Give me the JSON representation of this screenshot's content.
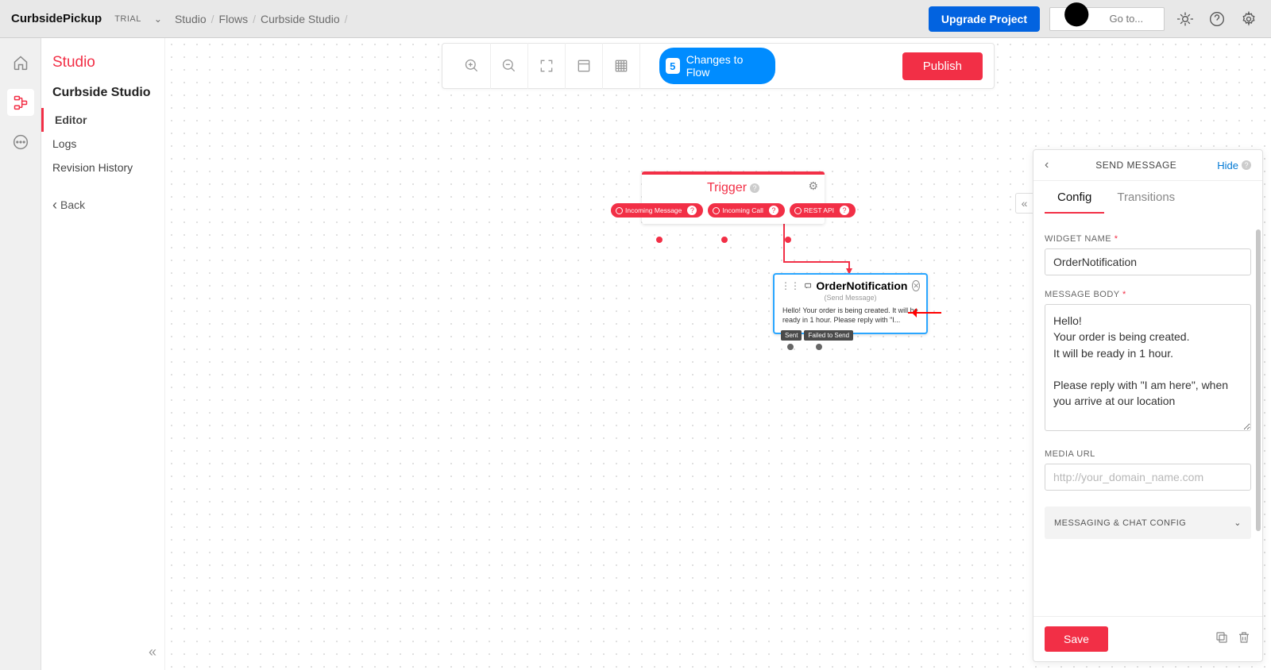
{
  "topbar": {
    "project_name": "CurbsidePickup",
    "trial_label": "TRIAL",
    "breadcrumbs": [
      "Studio",
      "Flows",
      "Curbside Studio"
    ],
    "upgrade_label": "Upgrade Project",
    "search_placeholder": "Go to..."
  },
  "sidebar": {
    "title": "Studio",
    "flow_name": "Curbside Studio",
    "items": [
      {
        "label": "Editor",
        "active": true
      },
      {
        "label": "Logs",
        "active": false
      },
      {
        "label": "Revision History",
        "active": false
      }
    ],
    "back_label": "Back"
  },
  "canvas_toolbar": {
    "changes_count": "5",
    "changes_label": "Changes to Flow",
    "publish_label": "Publish"
  },
  "trigger_widget": {
    "title": "Trigger",
    "ports": [
      "Incoming Message",
      "Incoming Call",
      "REST API"
    ]
  },
  "order_widget": {
    "title": "OrderNotification",
    "subtitle": "(Send Message)",
    "preview": "Hello! Your order is being created. It will be ready in 1 hour. Please reply with \"I...",
    "status_ports": [
      "Sent",
      "Failed to Send"
    ]
  },
  "panel": {
    "title": "SEND MESSAGE",
    "hide_label": "Hide",
    "tabs": {
      "config": "Config",
      "transitions": "Transitions"
    },
    "labels": {
      "widget_name": "WIDGET NAME",
      "message_body": "MESSAGE BODY",
      "media_url": "MEDIA URL",
      "messaging_config": "MESSAGING & CHAT CONFIG"
    },
    "widget_name_value": "OrderNotification",
    "message_body_value": "Hello!\nYour order is being created.\nIt will be ready in 1 hour.\n\nPlease reply with \"I am here\", when you arrive at our location",
    "media_url_placeholder": "http://your_domain_name.com",
    "save_label": "Save"
  }
}
